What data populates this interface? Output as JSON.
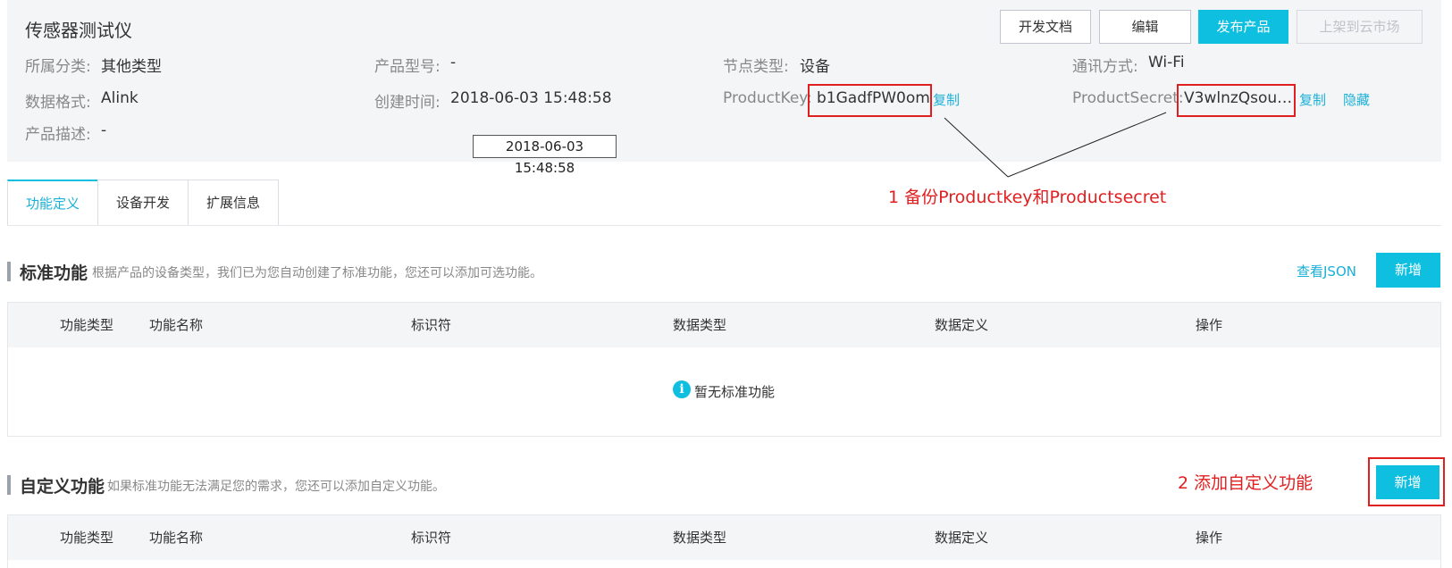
{
  "header": {
    "title": "传感器测试仪",
    "buttons": {
      "dev_docs": "开发文档",
      "edit": "编辑",
      "publish": "发布产品",
      "market": "上架到云市场"
    },
    "fields": {
      "category_label": "所属分类:",
      "category_value": "其他类型",
      "model_label": "产品型号:",
      "model_value": "-",
      "node_label": "节点类型:",
      "node_value": "设备",
      "comm_label": "通讯方式:",
      "comm_value": "Wi-Fi",
      "format_label": "数据格式:",
      "format_value": "Alink",
      "created_label": "创建时间:",
      "created_value": "2018-06-03 15:48:58",
      "pk_label": "ProductKey:",
      "pk_value": "b1GadfPW0om",
      "pk_copy": "复制",
      "ps_label": "ProductSecret:",
      "ps_value": "V3wlnzQsou…",
      "ps_copy": "复制",
      "ps_hide": "隐藏",
      "desc_label": "产品描述:",
      "desc_value": "-"
    },
    "tooltip": "2018-06-03 15:48:58"
  },
  "tabs": [
    "功能定义",
    "设备开发",
    "扩展信息"
  ],
  "annotations": {
    "step1": "1  备份Productkey和Productsecret",
    "step2": "2   添加自定义功能"
  },
  "standard": {
    "title": "标准功能",
    "desc": "根据产品的设备类型，我们已为您自动创建了标准功能，您还可以添加可选功能。",
    "view_json": "查看JSON",
    "add": "新增",
    "columns": [
      "功能类型",
      "功能名称",
      "标识符",
      "数据类型",
      "数据定义",
      "操作"
    ],
    "empty_text": "暂无标准功能"
  },
  "custom": {
    "title": "自定义功能",
    "desc": "如果标准功能无法满足您的需求，您还可以添加自定义功能。",
    "add": "新增",
    "columns": [
      "功能类型",
      "功能名称",
      "标识符",
      "数据类型",
      "数据定义",
      "操作"
    ]
  },
  "colors": {
    "accent": "#0fbfe0",
    "annotation": "#e02020",
    "header_bg": "#f4f5f7"
  },
  "icons": {
    "info": "info-icon"
  }
}
